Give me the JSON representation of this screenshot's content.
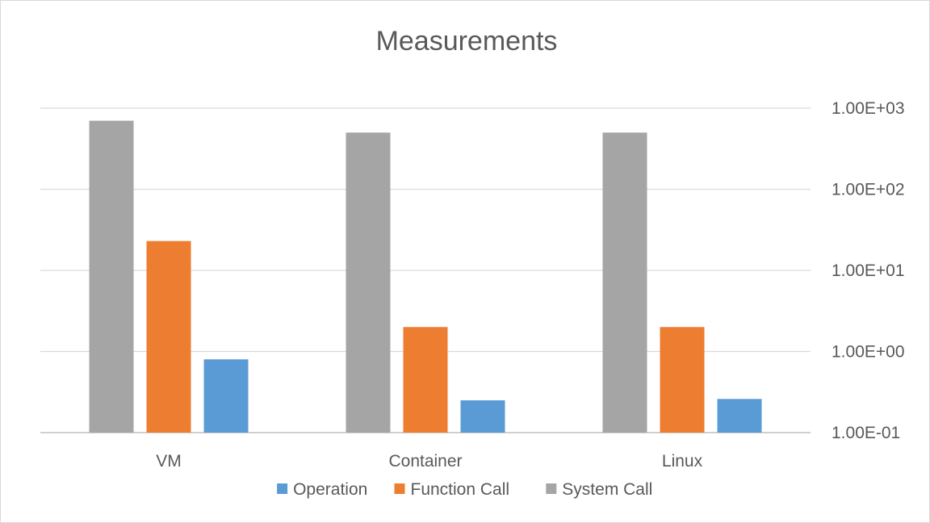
{
  "chart_data": {
    "type": "bar",
    "title": "Measurements",
    "xlabel": "",
    "ylabel": "",
    "y_scale": "log",
    "y_axis_position": "right",
    "ylim": [
      0.1,
      1000
    ],
    "y_ticks": [
      0.1,
      1,
      10,
      100,
      1000
    ],
    "y_tick_labels": [
      "1.00E-01",
      "1.00E+00",
      "1.00E+01",
      "1.00E+02",
      "1.00E+03"
    ],
    "grid": true,
    "legend_position": "bottom",
    "categories": [
      "VM",
      "Container",
      "Linux"
    ],
    "bar_order": [
      "System Call",
      "Function Call",
      "Operation"
    ],
    "series": [
      {
        "name": "Operation",
        "color": "#5b9bd5",
        "values": [
          0.8,
          0.25,
          0.26
        ]
      },
      {
        "name": "Function Call",
        "color": "#ed7d31",
        "values": [
          23,
          2,
          2
        ]
      },
      {
        "name": "System Call",
        "color": "#a5a5a5",
        "values": [
          700,
          500,
          500
        ]
      }
    ]
  }
}
